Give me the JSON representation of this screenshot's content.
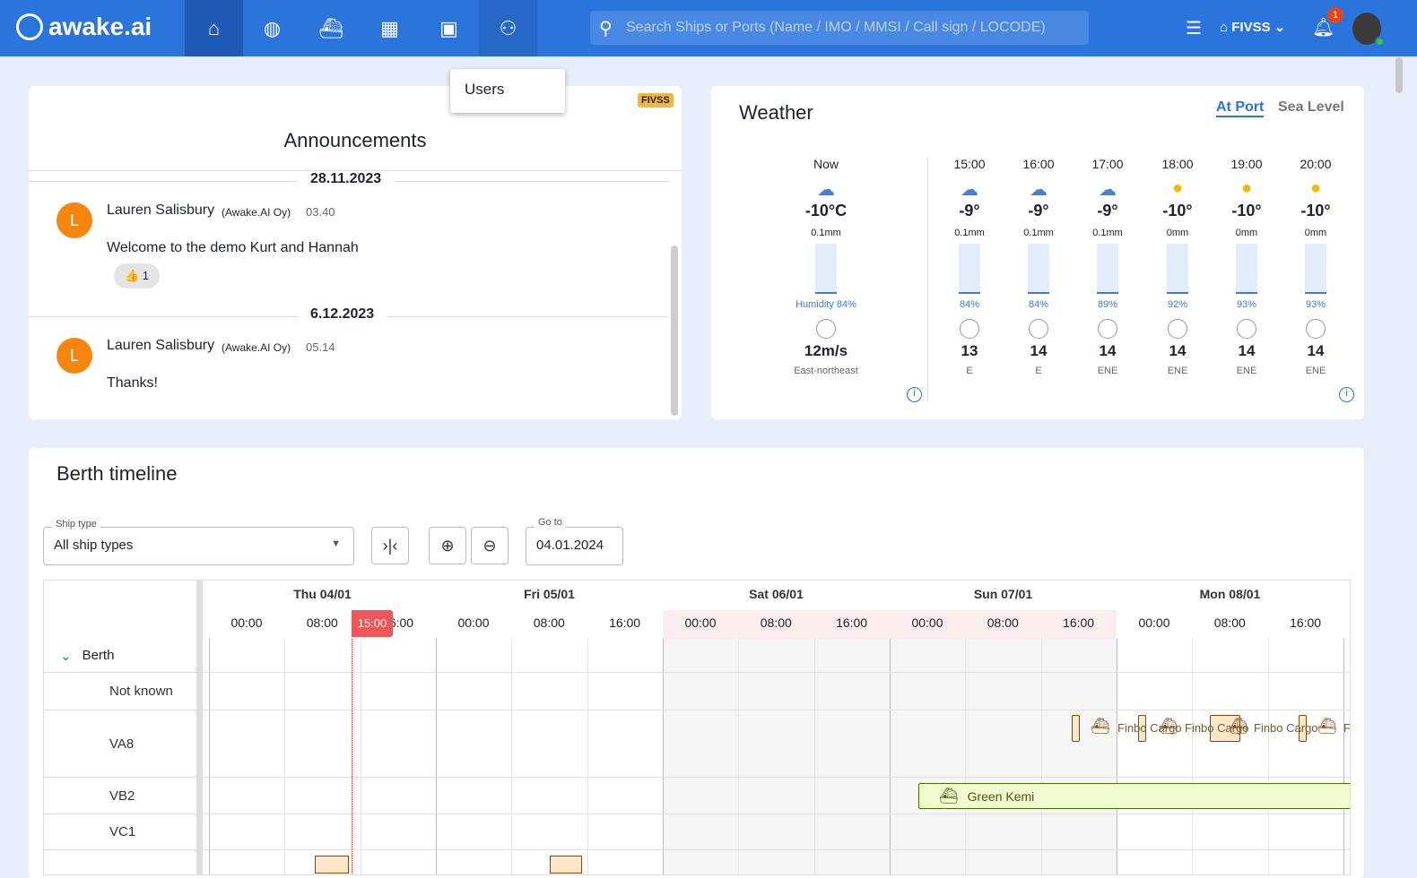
{
  "header": {
    "logo": "awake.ai",
    "nav": [
      "home-icon",
      "globe-icon",
      "port-icon",
      "calendar-icon",
      "apps-icon",
      "users-icon"
    ],
    "search_placeholder": "Search Ships or Ports (Name / IMO / MMSI / Call sign / LOCODE)",
    "port": "FIVSS",
    "notifications": "1",
    "dropdown_item": "Users"
  },
  "announcements": {
    "title": "Announcements",
    "badge": "FIVSS",
    "items": [
      {
        "date": "28.11.2023",
        "avatar": "L",
        "author": "Lauren Salisbury",
        "org": "(Awake.AI Oy)",
        "time": "03.40",
        "text": "Welcome to the demo Kurt and Hannah",
        "reaction": "👍 1"
      },
      {
        "date": "6.12.2023",
        "avatar": "L",
        "author": "Lauren Salisbury",
        "org": "(Awake.AI Oy)",
        "time": "05.14",
        "text": "Thanks!"
      }
    ]
  },
  "weather": {
    "title": "Weather",
    "tabs": [
      "At Port",
      "Sea Level"
    ],
    "active_tab": "At Port",
    "now": {
      "t": "Now",
      "icon": "snow-cloud",
      "temp": "-10°C",
      "mm": "0.1mm",
      "hum": "Humidity 84%",
      "ws": "12m/s",
      "wd": "East-northeast"
    },
    "hours": [
      {
        "t": "15:00",
        "icon": "snow-cloud",
        "temp": "-9°",
        "mm": "0.1mm",
        "hum": "84%",
        "ws": "13",
        "wd": "E"
      },
      {
        "t": "16:00",
        "icon": "snow-cloud",
        "temp": "-9°",
        "mm": "0.1mm",
        "hum": "84%",
        "ws": "14",
        "wd": "E"
      },
      {
        "t": "17:00",
        "icon": "snow-cloud",
        "temp": "-9°",
        "mm": "0.1mm",
        "hum": "89%",
        "ws": "14",
        "wd": "ENE"
      },
      {
        "t": "18:00",
        "icon": "sun",
        "temp": "-10°",
        "mm": "0mm",
        "hum": "92%",
        "ws": "14",
        "wd": "ENE"
      },
      {
        "t": "19:00",
        "icon": "sun",
        "temp": "-10°",
        "mm": "0mm",
        "hum": "93%",
        "ws": "14",
        "wd": "ENE"
      },
      {
        "t": "20:00",
        "icon": "sun",
        "temp": "-10°",
        "mm": "0mm",
        "hum": "93%",
        "ws": "14",
        "wd": "ENE"
      }
    ]
  },
  "berth": {
    "title": "Berth timeline",
    "ship_type_label": "Ship type",
    "ship_type": "All ship types",
    "goto_label": "Go to",
    "goto": "04.01.2024",
    "days": [
      "Thu 04/01",
      "Fri 05/01",
      "Sat 06/01",
      "Sun 07/01",
      "Mon 08/01"
    ],
    "hours": [
      "00:00",
      "08:00",
      "16:00"
    ],
    "now": "15:00",
    "group": "Berth",
    "rows": [
      "Not known",
      "VA8",
      "VB2",
      "VC1"
    ],
    "vessels": {
      "va8": "Finbo Cargo",
      "vb2": "Green Kemi"
    }
  }
}
